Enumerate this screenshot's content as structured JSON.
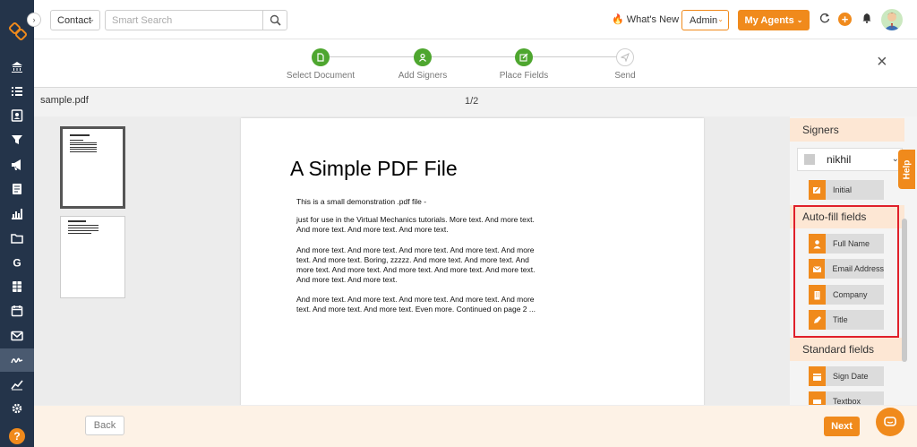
{
  "topbar": {
    "contact_select": "Contact",
    "search_placeholder": "Smart Search",
    "whats_new": "What's New",
    "admin": "Admin",
    "my_agents": "My Agents",
    "add_symbol": "+"
  },
  "stepper": {
    "steps": [
      {
        "label": "Select Document",
        "state": "done",
        "icon": "document-icon"
      },
      {
        "label": "Add Signers",
        "state": "done",
        "icon": "user-icon"
      },
      {
        "label": "Place Fields",
        "state": "done",
        "icon": "edit-icon"
      },
      {
        "label": "Send",
        "state": "pending",
        "icon": "send-icon"
      }
    ],
    "close_symbol": "×"
  },
  "document": {
    "file_name": "sample.pdf",
    "page_indicator": "1/2",
    "title": "A Simple PDF File",
    "paragraphs": [
      "This is a small demonstration .pdf file -",
      "just for use in the Virtual Mechanics tutorials. More text. And more text. And more text. And more text. And more text.",
      "And more text. And more text. And more text. And more text. And more text. And more text. Boring, zzzzz. And more text. And more text. And more text. And more text. And more text. And more text. And more text. And more text. And more text.",
      "And more text. And more text. And more text. And more text. And more text. And more text. And more text. Even more. Continued on page 2 ..."
    ]
  },
  "panel": {
    "signers_heading": "Signers",
    "signer_name": "nikhil",
    "signer_fields": [
      {
        "label": "Initial",
        "icon": "initial-icon"
      }
    ],
    "autofill_heading": "Auto-fill fields",
    "autofill_fields": [
      {
        "label": "Full Name",
        "icon": "person-icon"
      },
      {
        "label": "Email Address",
        "icon": "envelope-icon"
      },
      {
        "label": "Company",
        "icon": "building-icon"
      },
      {
        "label": "Title",
        "icon": "pen-nib-icon"
      }
    ],
    "standard_heading": "Standard fields",
    "standard_fields": [
      {
        "label": "Sign Date",
        "icon": "calendar-icon"
      },
      {
        "label": "Textbox",
        "icon": "textbox-icon"
      }
    ]
  },
  "help_tab": "Help",
  "footer": {
    "back": "Back",
    "next": "Next"
  },
  "colors": {
    "accent": "#f08a1c",
    "nav_bg": "#24344a",
    "step_done": "#4ea62f",
    "highlight": "#e0202a"
  }
}
